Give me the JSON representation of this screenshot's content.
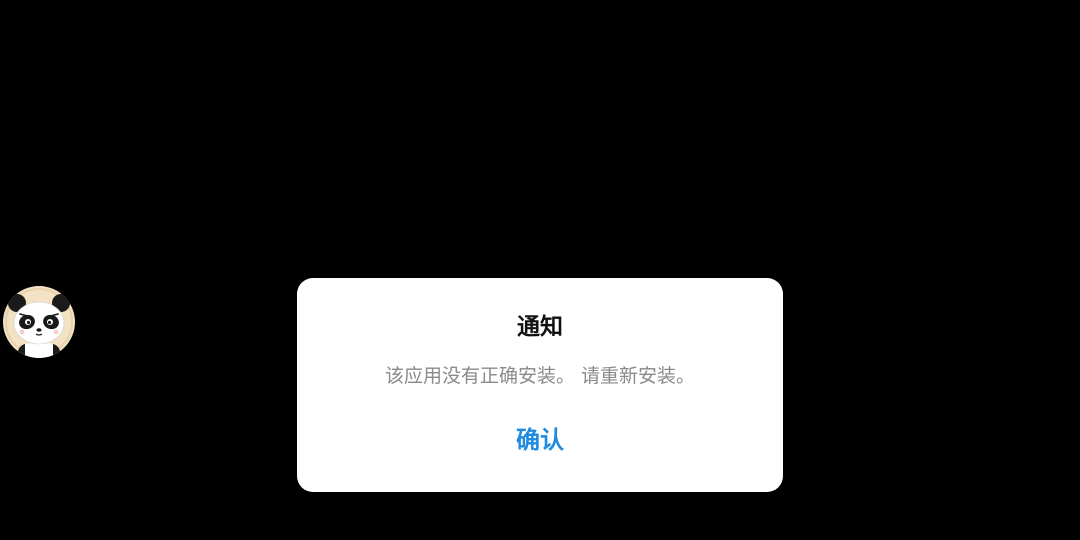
{
  "floating_avatar": {
    "icon": "panda-face-icon",
    "background_color": "#f3e2c4"
  },
  "dialog": {
    "title": "通知",
    "message": "该应用没有正确安装。 请重新安装。",
    "confirm_label": "确认",
    "confirm_color": "#1e8ae0"
  }
}
